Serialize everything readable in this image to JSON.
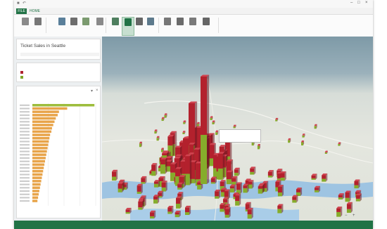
{
  "window": {
    "title": "",
    "file_tab": "FILE",
    "home_tab": "HOME"
  },
  "ribbon": {
    "buttons": [
      {
        "label": "",
        "icon": "play-tour-icon",
        "color": "#8a8a8a"
      },
      {
        "label": "",
        "icon": "new-scene-icon",
        "color": "#777777"
      },
      {
        "label": "",
        "icon": "theme-icon",
        "color": "#5a7f9a"
      },
      {
        "label": "",
        "icon": "map-labels-icon",
        "color": "#6d6d6d"
      },
      {
        "label": "",
        "icon": "flat-map-icon",
        "color": "#7c9b70"
      },
      {
        "label": "",
        "icon": "find-location-icon",
        "color": "#8a8a8a"
      },
      {
        "label": "",
        "icon": "column-chart-icon",
        "color": "#4f7f5f"
      },
      {
        "label": "",
        "icon": "layer-pane-icon",
        "color": "#217346",
        "active": true
      },
      {
        "label": "",
        "icon": "text-box-icon",
        "color": "#666666"
      },
      {
        "label": "",
        "icon": "legend-icon",
        "color": "#5d7a8c"
      },
      {
        "label": "",
        "icon": "chart-icon",
        "color": "#777777"
      },
      {
        "label": "",
        "icon": "time-line-icon",
        "color": "#6b6b6b"
      },
      {
        "label": "",
        "icon": "date-time-icon",
        "color": "#7a7a7a"
      },
      {
        "label": "",
        "icon": "shapes-icon",
        "color": "#666666"
      }
    ]
  },
  "tour": {
    "title": "Ticket Sales in Seattle",
    "subtitle": ""
  },
  "legend": {
    "title": "",
    "items": [
      {
        "label": "",
        "color": "#b02330"
      },
      {
        "label": "",
        "color": "#7fa62a"
      }
    ]
  },
  "chart": {
    "title": "",
    "subtitle": "",
    "rows": [
      0.98,
      0.55,
      0.42,
      0.4,
      0.37,
      0.35,
      0.33,
      0.31,
      0.3,
      0.28,
      0.27,
      0.26,
      0.25,
      0.24,
      0.23,
      0.22,
      0.21,
      0.2,
      0.19,
      0.18,
      0.17,
      0.16,
      0.15,
      0.14,
      0.13,
      0.12,
      0.11,
      0.1,
      0.09,
      0.08
    ],
    "bar_color": "#e8a44a",
    "top_bar_color": "#9dbd3c"
  },
  "map": {
    "tooltip_title": "",
    "tooltip_detail": "",
    "series_colors": {
      "red": "#b3212d",
      "green": "#86ac2b"
    }
  },
  "status": {
    "left": "",
    "right": ""
  }
}
